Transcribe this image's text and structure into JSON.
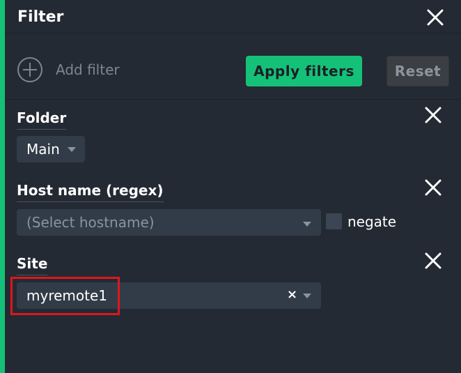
{
  "header": {
    "title": "Filter"
  },
  "toolbar": {
    "add_filter_label": "Add filter",
    "apply_label": "Apply filters",
    "reset_label": "Reset"
  },
  "filters": {
    "folder": {
      "label": "Folder",
      "value": "Main"
    },
    "host_name": {
      "label": "Host name (regex)",
      "placeholder": "(Select hostname)",
      "negate_label": "negate"
    },
    "site": {
      "label": "Site",
      "value": "myremote1",
      "clear_glyph": "×"
    }
  },
  "colors": {
    "accent": "#15c179",
    "background": "#232a33",
    "field": "#323c48",
    "highlight": "#e0161c"
  }
}
